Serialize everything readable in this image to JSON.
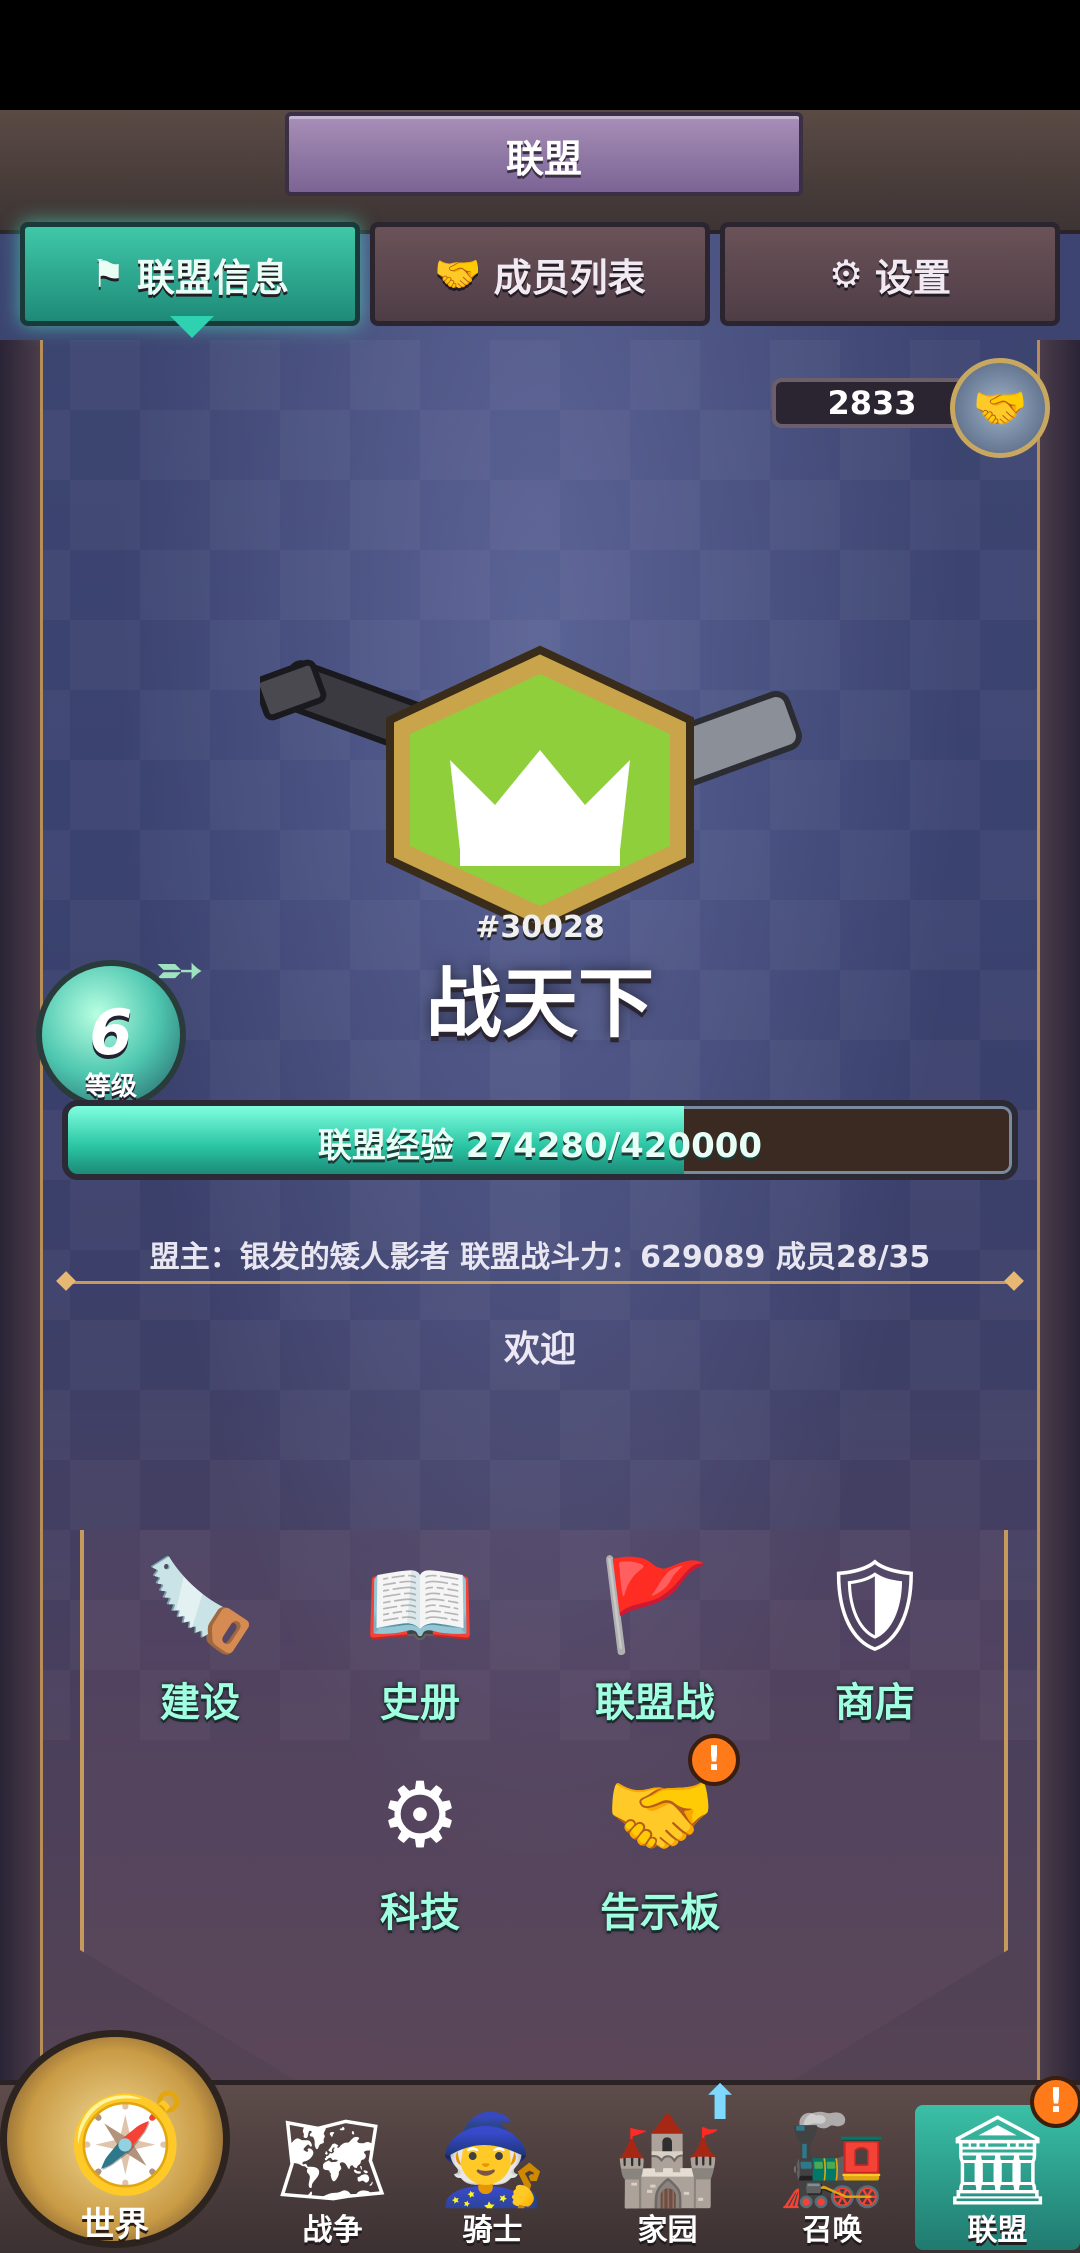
{
  "header": {
    "title": "联盟"
  },
  "tabs": [
    {
      "label": "联盟信息",
      "icon": "flag-icon",
      "active": true
    },
    {
      "label": "成员列表",
      "icon": "handshake-icon",
      "active": false
    },
    {
      "label": "设置",
      "icon": "gear-icon",
      "active": false
    }
  ],
  "alliance": {
    "points": "2833",
    "id": "#30028",
    "name": "战天下",
    "level": "6",
    "level_label": "等级",
    "exp_text": "联盟经验 274280/420000",
    "exp_progress": 0.653,
    "info_line": "盟主：银发的矮人影者  联盟战斗力：629089  成员28/35",
    "welcome": "欢迎"
  },
  "menu": [
    {
      "label": "建设",
      "icon": "crossed-saws-icon"
    },
    {
      "label": "史册",
      "icon": "history-book-icon"
    },
    {
      "label": "联盟战",
      "icon": "red-flag-icon"
    },
    {
      "label": "商店",
      "icon": "shop-icon"
    },
    {
      "label": "科技",
      "icon": "tech-gear-icon"
    },
    {
      "label": "告示板",
      "icon": "notice-board-icon",
      "alert": "!"
    }
  ],
  "bottom_nav": [
    {
      "label": "世界",
      "icon": "compass-icon"
    },
    {
      "label": "战争",
      "icon": "map-icon"
    },
    {
      "label": "骑士",
      "icon": "knight-icon"
    },
    {
      "label": "家园",
      "icon": "home-icon"
    },
    {
      "label": "召唤",
      "icon": "train-icon"
    },
    {
      "label": "联盟",
      "icon": "alliance-icon",
      "active": true,
      "alert": "!"
    }
  ],
  "colors": {
    "accent": "#2fd2b0",
    "alert": "#ff7a18",
    "gold": "#c69a5c"
  }
}
